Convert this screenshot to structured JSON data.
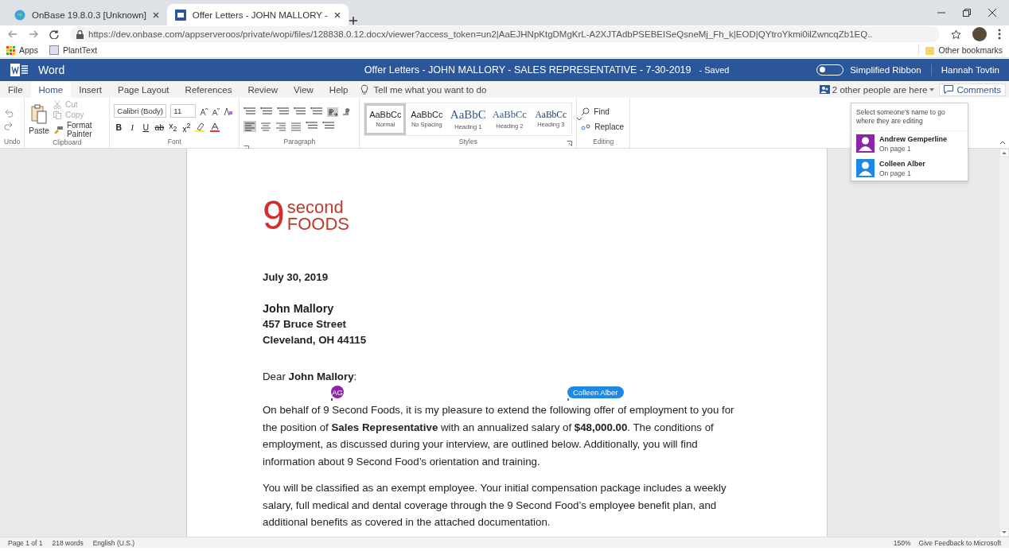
{
  "browser": {
    "tabs": [
      {
        "title": "OnBase 19.8.0.3 [Unknown]",
        "kind": "globe",
        "selected": false
      },
      {
        "title": "Offer Letters - JOHN MALLORY -",
        "kind": "word",
        "selected": true
      }
    ],
    "url": "https://dev.onbase.com/appserveroos/private/wopi/files/128838.0.12.docx/viewer?access_token=un2|AaEJHNpKtgDMgKrL-A2XJTAdbPSEBEISeQsneMj_Fh_k|EOD|QYtroYkmi0ilZwncqZb1EQ..",
    "bookmarks": [
      {
        "label": "Apps",
        "kind": "apps"
      },
      {
        "label": "PlantText",
        "kind": "page"
      }
    ],
    "other_bookmarks": "Other bookmarks"
  },
  "word": {
    "app_name": "Word",
    "doc_title": "Offer Letters - JOHN MALLORY - SALES REPRESENTATIVE - 7-30-2019",
    "save_status": "-  Saved",
    "simplified_ribbon": {
      "label": "Simplified Ribbon",
      "on": false
    },
    "user": "Hannah Tovtin"
  },
  "menu_tabs": [
    {
      "label": "File",
      "selected": false
    },
    {
      "label": "Home",
      "selected": true
    },
    {
      "label": "Insert",
      "selected": false
    },
    {
      "label": "Page Layout",
      "selected": false
    },
    {
      "label": "References",
      "selected": false
    },
    {
      "label": "Review",
      "selected": false
    },
    {
      "label": "View",
      "selected": false
    },
    {
      "label": "Help",
      "selected": false
    }
  ],
  "tell_me": "Tell me what you want to do",
  "presence": "2 other people are here",
  "comments": "Comments",
  "ribbon": {
    "undo_label": "Undo",
    "clipboard": {
      "paste": "Paste",
      "cut": {
        "label": "Cut",
        "disabled": true
      },
      "copy": {
        "label": "Copy",
        "disabled": true
      },
      "format_painter": {
        "label": "Format Painter",
        "disabled": false
      },
      "label": "Clipboard"
    },
    "font": {
      "family": "Calibri (Body)",
      "size": "11",
      "format_buttons": [
        "B",
        "I",
        "U",
        "ab",
        "x$_{2}$",
        "x$^{2}$"
      ],
      "label": "Font"
    },
    "paragraph": {
      "label": "Paragraph"
    },
    "styles": {
      "items": [
        {
          "preview": "AaBbCc",
          "name": "Normal",
          "kind": "normal",
          "selected": true
        },
        {
          "preview": "AaBbCc",
          "name": "No Spacing",
          "kind": "normal",
          "selected": false
        },
        {
          "preview": "AaBbC",
          "name": "Heading 1",
          "kind": "h1",
          "selected": false
        },
        {
          "preview": "AaBbCc",
          "name": "Heading 2",
          "kind": "h2",
          "selected": false
        },
        {
          "preview": "AaBbCc",
          "name": "Heading 3",
          "kind": "h3",
          "selected": false
        }
      ],
      "label": "Styles"
    },
    "editing": {
      "find": "Find",
      "replace": "Replace",
      "label": "Editing"
    }
  },
  "document": {
    "logo": {
      "numeral": "9",
      "top": "second",
      "bottom": "FOODS"
    },
    "date": "July 30, 2019",
    "recipient": [
      "John Mallory",
      "457 Bruce Street",
      "Cleveland, OH 44115"
    ],
    "salutation": "Dear **John Mallory**:",
    "paragraphs": [
      "On behalf of 9 Second Foods, it is my pleasure to extend the following offer of employment to you for the position of **Sales Representative** with an annualized salary of **$48,000.00**.  The conditions of employment, as discussed during your interview, are outlined below. Additionally, you will find information about 9 Second Food’s orientation and training.",
      "You will be classified as an exempt employee. Your initial compensation package includes a weekly salary, full medical and dental coverage through the 9 Second Food’s employee benefit plan, and additional benefits as covered in the attached documentation."
    ],
    "cursors": [
      {
        "label": "AG",
        "kind": "initials",
        "color": "#8e24aa"
      },
      {
        "label": "Colleen Alber",
        "kind": "name",
        "color": "#1e88e5"
      }
    ]
  },
  "people_popup": {
    "hint": "Select someone's name to go where they are editing",
    "people": [
      {
        "name": "Andrew Gemperline",
        "location": "On page 1",
        "color": "#8e24aa"
      },
      {
        "name": "Colleen Alber",
        "location": "On page 1",
        "color": "#1e88e5"
      }
    ]
  },
  "status_bar": {
    "items": [
      "Page 1 of 1",
      "218 words",
      "English (U.S.)"
    ],
    "zoom": "150%",
    "feedback": "Give Feedback to Microsoft"
  }
}
